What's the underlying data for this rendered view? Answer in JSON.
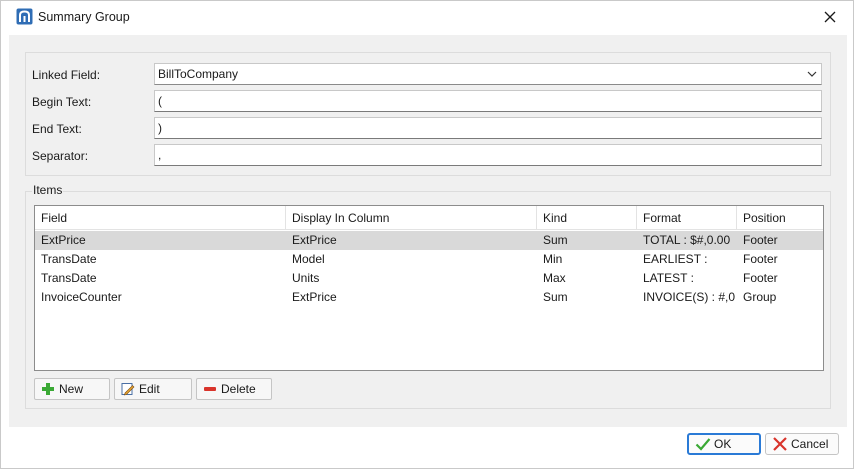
{
  "window": {
    "title": "Summary Group",
    "icon": "report-app-icon",
    "close_icon": "close-icon"
  },
  "form": {
    "linked_field": {
      "label": "Linked Field:",
      "value": "BillToCompany"
    },
    "begin_text": {
      "label": "Begin Text:",
      "value": "("
    },
    "end_text": {
      "label": "End Text:",
      "value": ")"
    },
    "separator": {
      "label": "Separator:",
      "value": ","
    }
  },
  "items": {
    "label": "Items",
    "columns": [
      "Field",
      "Display In Column",
      "Kind",
      "Format",
      "Position"
    ],
    "rows": [
      {
        "field": "ExtPrice",
        "display": "ExtPrice",
        "kind": "Sum",
        "format": "TOTAL : $#,0.00",
        "position": "Footer",
        "selected": true
      },
      {
        "field": "TransDate",
        "display": "Model",
        "kind": "Min",
        "format": "EARLIEST :",
        "position": "Footer",
        "selected": false
      },
      {
        "field": "TransDate",
        "display": "Units",
        "kind": "Max",
        "format": "LATEST :",
        "position": "Footer",
        "selected": false
      },
      {
        "field": "InvoiceCounter",
        "display": "ExtPrice",
        "kind": "Sum",
        "format": "INVOICE(S) : #,0",
        "position": "Group",
        "selected": false
      }
    ],
    "buttons": {
      "new": "New",
      "edit": "Edit",
      "delete": "Delete"
    }
  },
  "footer": {
    "ok": "OK",
    "cancel": "Cancel"
  },
  "colors": {
    "accent": "#2a7ad6",
    "selected_row": "#d9d9d9",
    "plus_green": "#3aa935",
    "delete_red": "#d9342b",
    "cancel_red": "#d9342b",
    "ok_green": "#3aa935"
  }
}
